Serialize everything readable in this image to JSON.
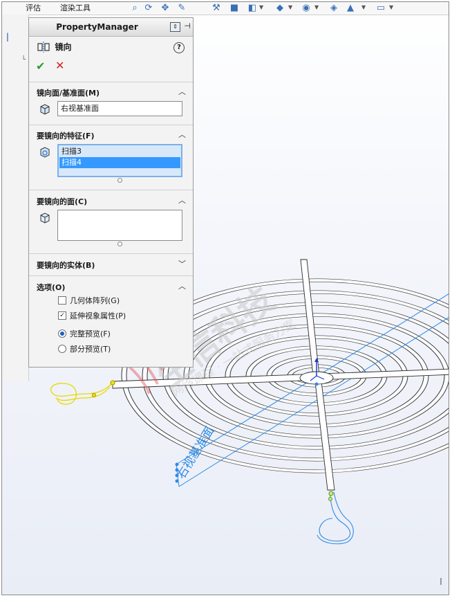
{
  "toolbar": {
    "tab1": "评估",
    "tab2": "渲染工具",
    "icons": [
      "sketch-tool-icon",
      "view-orient-icon",
      "display-style-icon",
      "section-view-icon",
      "hide-show-icon",
      "appearance-icon",
      "scene-icon",
      "monitor-icon"
    ]
  },
  "pm": {
    "header_title": "PropertyManager",
    "feature_title": "镜向",
    "help": "?",
    "ok": "✔",
    "cancel": "✕",
    "sections": {
      "mirror_plane": {
        "title": "镜向面/基准面(M)",
        "value": "右视基准面"
      },
      "features": {
        "title": "要镜向的特征(F)",
        "items": [
          "扫描3",
          "扫描4"
        ],
        "selected_index": 1
      },
      "faces": {
        "title": "要镜向的面(C)"
      },
      "bodies": {
        "title": "要镜向的实体(B)"
      },
      "options": {
        "title": "选项(O)",
        "geometry_pattern": "几何体阵列(G)",
        "geometry_pattern_checked": false,
        "propagate_visual": "延伸视象属性(P)",
        "propagate_visual_checked": true,
        "full_preview": "完整预览(F)",
        "partial_preview": "部分预览(T)",
        "preview_mode": "full"
      }
    }
  },
  "viewport": {
    "plane_label": "右视基准面",
    "watermark_main": "生信科技",
    "watermark_sub": "网络课程 · 一站式服务方案",
    "colors": {
      "plane": "#2f8be6",
      "highlight": "#f0e020",
      "wire": "#d0d0d0",
      "watermark": "#d04040"
    }
  }
}
